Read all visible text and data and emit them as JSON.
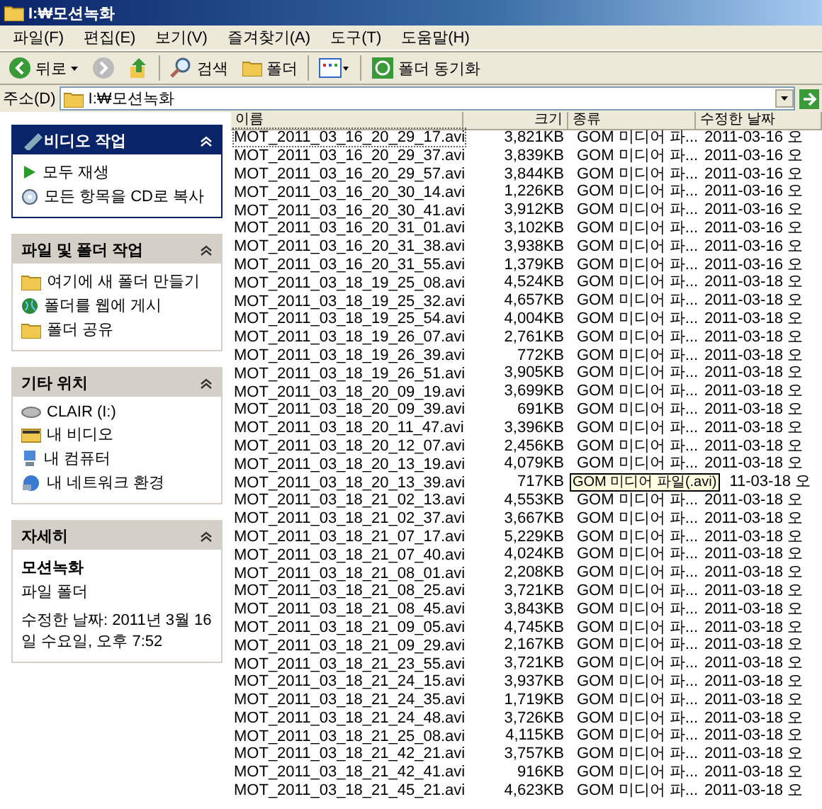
{
  "window": {
    "title": "I:₩모션녹화"
  },
  "menu": [
    "파일(F)",
    "편집(E)",
    "보기(V)",
    "즐겨찾기(A)",
    "도구(T)",
    "도움말(H)"
  ],
  "toolbar": {
    "back": "뒤로",
    "search": "검색",
    "folders": "폴더",
    "sync": "폴더 동기화"
  },
  "address": {
    "label": "주소(D)",
    "value": "I:₩모션녹화"
  },
  "sidebar": [
    {
      "kind": "tasks",
      "title": "비디오 작업",
      "primary": true,
      "items": [
        {
          "label": "모두 재생"
        },
        {
          "label": "모든 항목을 CD로 복사"
        }
      ]
    },
    {
      "kind": "tasks",
      "title": "파일 및 폴더 작업",
      "primary": false,
      "items": [
        {
          "label": "여기에 새 폴더 만들기"
        },
        {
          "label": "폴더를 웹에 게시"
        },
        {
          "label": "폴더 공유"
        }
      ]
    },
    {
      "kind": "tasks",
      "title": "기타 위치",
      "primary": false,
      "items": [
        {
          "label": "CLAIR (I:)"
        },
        {
          "label": "내 비디오"
        },
        {
          "label": "내 컴퓨터"
        },
        {
          "label": "내 네트워크 환경"
        }
      ]
    },
    {
      "kind": "details",
      "title": "자세히",
      "primary": false,
      "name": "모션녹화",
      "type": "파일 폴더",
      "modified": "수정한 날짜: 2011년 3월 16일 수요일, 오후 7:52"
    }
  ],
  "columns": [
    "이름",
    "크기",
    "종류",
    "수정한 날짜"
  ],
  "rows": [
    {
      "name": "MOT_2011_03_16_20_29_17.avi",
      "size": "3,821KB",
      "type": "GOM 미디어 파...",
      "date": "2011-03-16 오",
      "focused": true
    },
    {
      "name": "MOT_2011_03_16_20_29_37.avi",
      "size": "3,839KB",
      "type": "GOM 미디어 파...",
      "date": "2011-03-16 오",
      "focused": false
    },
    {
      "name": "MOT_2011_03_16_20_29_57.avi",
      "size": "3,844KB",
      "type": "GOM 미디어 파...",
      "date": "2011-03-16 오",
      "focused": false
    },
    {
      "name": "MOT_2011_03_16_20_30_14.avi",
      "size": "1,226KB",
      "type": "GOM 미디어 파...",
      "date": "2011-03-16 오",
      "focused": false
    },
    {
      "name": "MOT_2011_03_16_20_30_41.avi",
      "size": "3,912KB",
      "type": "GOM 미디어 파...",
      "date": "2011-03-16 오",
      "focused": false
    },
    {
      "name": "MOT_2011_03_16_20_31_01.avi",
      "size": "3,102KB",
      "type": "GOM 미디어 파...",
      "date": "2011-03-16 오",
      "focused": false
    },
    {
      "name": "MOT_2011_03_16_20_31_38.avi",
      "size": "3,938KB",
      "type": "GOM 미디어 파...",
      "date": "2011-03-16 오",
      "focused": false
    },
    {
      "name": "MOT_2011_03_16_20_31_55.avi",
      "size": "1,379KB",
      "type": "GOM 미디어 파...",
      "date": "2011-03-16 오",
      "focused": false
    },
    {
      "name": "MOT_2011_03_18_19_25_08.avi",
      "size": "4,524KB",
      "type": "GOM 미디어 파...",
      "date": "2011-03-18 오",
      "focused": false
    },
    {
      "name": "MOT_2011_03_18_19_25_32.avi",
      "size": "4,657KB",
      "type": "GOM 미디어 파...",
      "date": "2011-03-18 오",
      "focused": false
    },
    {
      "name": "MOT_2011_03_18_19_25_54.avi",
      "size": "4,004KB",
      "type": "GOM 미디어 파...",
      "date": "2011-03-18 오",
      "focused": false
    },
    {
      "name": "MOT_2011_03_18_19_26_07.avi",
      "size": "2,761KB",
      "type": "GOM 미디어 파...",
      "date": "2011-03-18 오",
      "focused": false
    },
    {
      "name": "MOT_2011_03_18_19_26_39.avi",
      "size": "772KB",
      "type": "GOM 미디어 파...",
      "date": "2011-03-18 오",
      "focused": false
    },
    {
      "name": "MOT_2011_03_18_19_26_51.avi",
      "size": "3,905KB",
      "type": "GOM 미디어 파...",
      "date": "2011-03-18 오",
      "focused": false
    },
    {
      "name": "MOT_2011_03_18_20_09_19.avi",
      "size": "3,699KB",
      "type": "GOM 미디어 파...",
      "date": "2011-03-18 오",
      "focused": false
    },
    {
      "name": "MOT_2011_03_18_20_09_39.avi",
      "size": "691KB",
      "type": "GOM 미디어 파...",
      "date": "2011-03-18 오",
      "focused": false
    },
    {
      "name": "MOT_2011_03_18_20_11_47.avi",
      "size": "3,396KB",
      "type": "GOM 미디어 파...",
      "date": "2011-03-18 오",
      "focused": false
    },
    {
      "name": "MOT_2011_03_18_20_12_07.avi",
      "size": "2,456KB",
      "type": "GOM 미디어 파...",
      "date": "2011-03-18 오",
      "focused": false
    },
    {
      "name": "MOT_2011_03_18_20_13_19.avi",
      "size": "4,079KB",
      "type": "GOM 미디어 파...",
      "date": "2011-03-18 오",
      "focused": false
    },
    {
      "name": "MOT_2011_03_18_20_13_39.avi",
      "size": "717KB",
      "tooltip": "GOM 미디어 파일(.avi)",
      "date": "11-03-18 오",
      "focused": false
    },
    {
      "name": "MOT_2011_03_18_21_02_13.avi",
      "size": "4,553KB",
      "type": "GOM 미디어 파...",
      "date": "2011-03-18 오",
      "focused": false
    },
    {
      "name": "MOT_2011_03_18_21_02_37.avi",
      "size": "3,667KB",
      "type": "GOM 미디어 파...",
      "date": "2011-03-18 오",
      "focused": false
    },
    {
      "name": "MOT_2011_03_18_21_07_17.avi",
      "size": "5,229KB",
      "type": "GOM 미디어 파...",
      "date": "2011-03-18 오",
      "focused": false
    },
    {
      "name": "MOT_2011_03_18_21_07_40.avi",
      "size": "4,024KB",
      "type": "GOM 미디어 파...",
      "date": "2011-03-18 오",
      "focused": false
    },
    {
      "name": "MOT_2011_03_18_21_08_01.avi",
      "size": "2,208KB",
      "type": "GOM 미디어 파...",
      "date": "2011-03-18 오",
      "focused": false
    },
    {
      "name": "MOT_2011_03_18_21_08_25.avi",
      "size": "3,721KB",
      "type": "GOM 미디어 파...",
      "date": "2011-03-18 오",
      "focused": false
    },
    {
      "name": "MOT_2011_03_18_21_08_45.avi",
      "size": "3,843KB",
      "type": "GOM 미디어 파...",
      "date": "2011-03-18 오",
      "focused": false
    },
    {
      "name": "MOT_2011_03_18_21_09_05.avi",
      "size": "4,745KB",
      "type": "GOM 미디어 파...",
      "date": "2011-03-18 오",
      "focused": false
    },
    {
      "name": "MOT_2011_03_18_21_09_29.avi",
      "size": "2,167KB",
      "type": "GOM 미디어 파...",
      "date": "2011-03-18 오",
      "focused": false
    },
    {
      "name": "MOT_2011_03_18_21_23_55.avi",
      "size": "3,721KB",
      "type": "GOM 미디어 파...",
      "date": "2011-03-18 오",
      "focused": false
    },
    {
      "name": "MOT_2011_03_18_21_24_15.avi",
      "size": "3,937KB",
      "type": "GOM 미디어 파...",
      "date": "2011-03-18 오",
      "focused": false
    },
    {
      "name": "MOT_2011_03_18_21_24_35.avi",
      "size": "1,719KB",
      "type": "GOM 미디어 파...",
      "date": "2011-03-18 오",
      "focused": false
    },
    {
      "name": "MOT_2011_03_18_21_24_48.avi",
      "size": "3,726KB",
      "type": "GOM 미디어 파...",
      "date": "2011-03-18 오",
      "focused": false
    },
    {
      "name": "MOT_2011_03_18_21_25_08.avi",
      "size": "4,115KB",
      "type": "GOM 미디어 파...",
      "date": "2011-03-18 오",
      "focused": false
    },
    {
      "name": "MOT_2011_03_18_21_42_21.avi",
      "size": "3,757KB",
      "type": "GOM 미디어 파...",
      "date": "2011-03-18 오",
      "focused": false
    },
    {
      "name": "MOT_2011_03_18_21_42_41.avi",
      "size": "916KB",
      "type": "GOM 미디어 파...",
      "date": "2011-03-18 오",
      "focused": false
    },
    {
      "name": "MOT_2011_03_18_21_45_21.avi",
      "size": "4,623KB",
      "type": "GOM 미디어 파...",
      "date": "2011-03-18 오",
      "focused": false
    }
  ]
}
